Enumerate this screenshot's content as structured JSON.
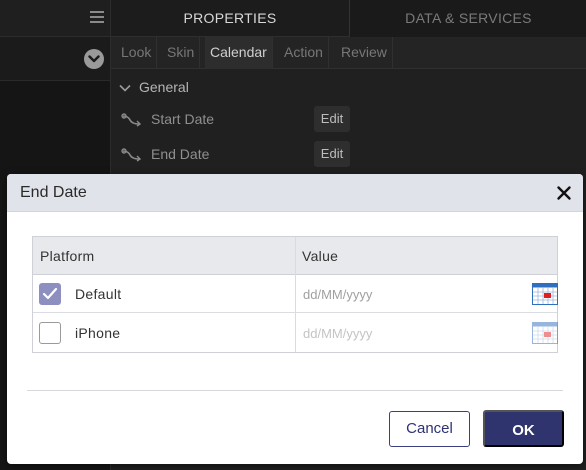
{
  "top_tabs": {
    "properties": "PROPERTIES",
    "data_services": "DATA & SERVICES"
  },
  "sub_tabs": [
    "Look",
    "Skin",
    "Calendar",
    "Action",
    "Review"
  ],
  "active_sub_tab": "Calendar",
  "section": {
    "title": "General"
  },
  "properties": [
    {
      "label": "Start Date",
      "button": "Edit"
    },
    {
      "label": "End Date",
      "button": "Edit"
    }
  ],
  "dialog": {
    "title": "End Date",
    "columns": {
      "platform": "Platform",
      "value": "Value"
    },
    "rows": [
      {
        "platform": "Default",
        "checked": true,
        "value": "",
        "placeholder": "dd/MM/yyyy"
      },
      {
        "platform": "iPhone",
        "checked": false,
        "value": "",
        "placeholder": "dd/MM/yyyy"
      }
    ],
    "cancel_label": "Cancel",
    "ok_label": "OK"
  },
  "colors": {
    "accent": "#2f336e",
    "checkbox_checked": "#8c8fc0",
    "dialog_header": "#e1e3ea",
    "calendar_mark": "#e02020"
  },
  "icons": [
    "hamburger-menu-icon",
    "chevron-down-icon",
    "expand-chevron-icon",
    "binding-icon",
    "close-icon",
    "checkmark-icon",
    "calendar-icon"
  ]
}
